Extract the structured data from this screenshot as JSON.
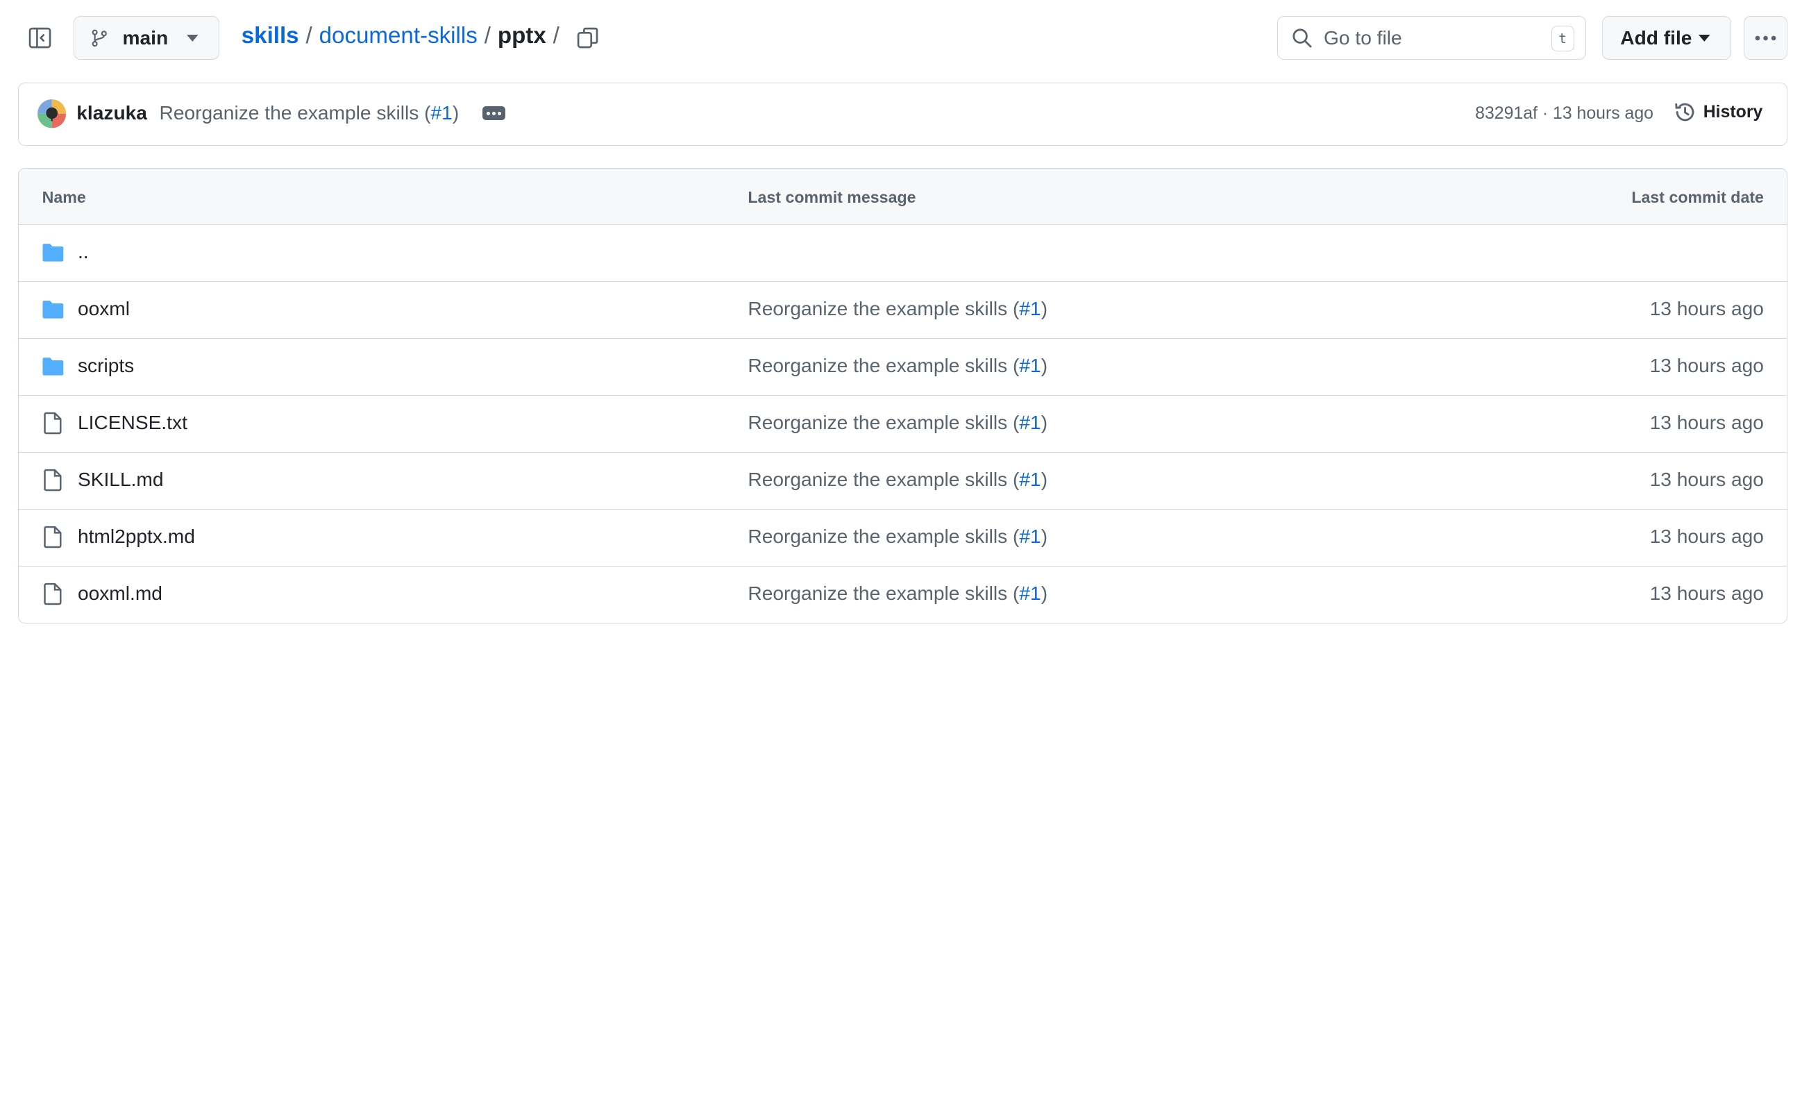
{
  "header": {
    "branch": "main",
    "breadcrumb": {
      "repo": "skills",
      "folder": "document-skills",
      "current": "pptx",
      "separator": "/"
    },
    "search": {
      "placeholder": "Go to file",
      "shortcut": "t"
    },
    "add_file_label": "Add file"
  },
  "latest_commit": {
    "author": "klazuka",
    "message": "Reorganize the example skills (",
    "pr": "#1",
    "message_end": ")",
    "hash": "83291af",
    "dot": "·",
    "time": "13 hours ago",
    "history_label": "History"
  },
  "table": {
    "columns": [
      "Name",
      "Last commit message",
      "Last commit date"
    ],
    "rows": [
      {
        "name": "..",
        "type": "folder",
        "message": "",
        "pr": "",
        "message_end": "",
        "date": ""
      },
      {
        "name": "ooxml",
        "type": "folder",
        "message": "Reorganize the example skills (",
        "pr": "#1",
        "message_end": ")",
        "date": "13 hours ago"
      },
      {
        "name": "scripts",
        "type": "folder",
        "message": "Reorganize the example skills (",
        "pr": "#1",
        "message_end": ")",
        "date": "13 hours ago"
      },
      {
        "name": "LICENSE.txt",
        "type": "file",
        "message": "Reorganize the example skills (",
        "pr": "#1",
        "message_end": ")",
        "date": "13 hours ago"
      },
      {
        "name": "SKILL.md",
        "type": "file",
        "message": "Reorganize the example skills (",
        "pr": "#1",
        "message_end": ")",
        "date": "13 hours ago"
      },
      {
        "name": "html2pptx.md",
        "type": "file",
        "message": "Reorganize the example skills (",
        "pr": "#1",
        "message_end": ")",
        "date": "13 hours ago"
      },
      {
        "name": "ooxml.md",
        "type": "file",
        "message": "Reorganize the example skills (",
        "pr": "#1",
        "message_end": ")",
        "date": "13 hours ago"
      }
    ]
  },
  "icons": {
    "sidebar_toggle": "sidebar-collapse-icon",
    "branch": "git-branch-icon",
    "copy": "copy-icon",
    "search": "search-icon",
    "more": "kebab-horizontal-icon",
    "history": "history-icon",
    "folder": "folder-icon",
    "file": "file-icon"
  },
  "colors": {
    "link": "#0969da",
    "folder": "#54aeff",
    "muted": "#59636e",
    "border": "#d1d9e0",
    "header_bg": "#f6f8fa"
  }
}
